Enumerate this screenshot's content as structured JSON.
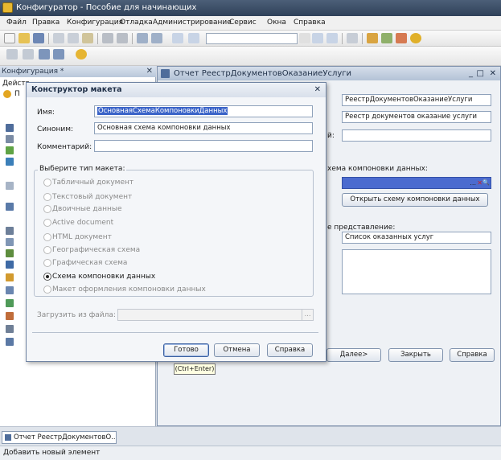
{
  "window": {
    "title": "Конфигуратор - Пособие для начинающих"
  },
  "menu": [
    "Файл",
    "Правка",
    "Конфигурация",
    "Отладка",
    "Администрирование",
    "Сервис",
    "Окна",
    "Справка"
  ],
  "left_panel": {
    "title": "Конфигурация *",
    "actions_label": "Действ",
    "first_item": "П"
  },
  "doc": {
    "title": "Отчет РеестрДокументовОказаниеУслуги",
    "name_value": "РеестрДокументовОказаниеУслуги",
    "synonym_value": "Реестр документов оказание услуги",
    "comment_partial_label": "й:",
    "schema_label": "хема компоновки данных:",
    "open_schema_button": "Открыть схему компоновки данных",
    "repr_label": "е представление:",
    "repr_value": "Список оказанных услуг",
    "next_button": "Далее>",
    "close_button": "Закрыть",
    "help_button": "Справка",
    "field_clear": "...",
    "field_x": "✕",
    "field_search": "🔍"
  },
  "dialog": {
    "title": "Конструктор макета",
    "close": "✕",
    "name_label": "Имя:",
    "name_value": "ОсновнаяСхемаКомпоновкиДанных",
    "synonym_label": "Синоним:",
    "synonym_value": "Основная схема компоновки данных",
    "comment_label": "Комментарий:",
    "comment_value": "",
    "group_label": "Выберите тип макета:",
    "options": [
      {
        "label": "Табличный документ",
        "selected": false
      },
      {
        "label": "Текстовый документ",
        "selected": false
      },
      {
        "label": "Двоичные данные",
        "selected": false
      },
      {
        "label": "Active document",
        "selected": false
      },
      {
        "label": "HTML документ",
        "selected": false
      },
      {
        "label": "Географическая схема",
        "selected": false
      },
      {
        "label": "Графическая схема",
        "selected": false
      },
      {
        "label": "Схема компоновки данных",
        "selected": true
      },
      {
        "label": "Макет оформления компоновки данных",
        "selected": false
      }
    ],
    "load_label": "Загрузить из файла:",
    "browse": "...",
    "ok_button": "Готово",
    "cancel_button": "Отмена",
    "help_button": "Справка"
  },
  "tooltip": "(Ctrl+Enter)",
  "taskbar": {
    "item": "Отчет РеестрДокументовО..."
  },
  "status": {
    "text": "Добавить новый элемент"
  }
}
